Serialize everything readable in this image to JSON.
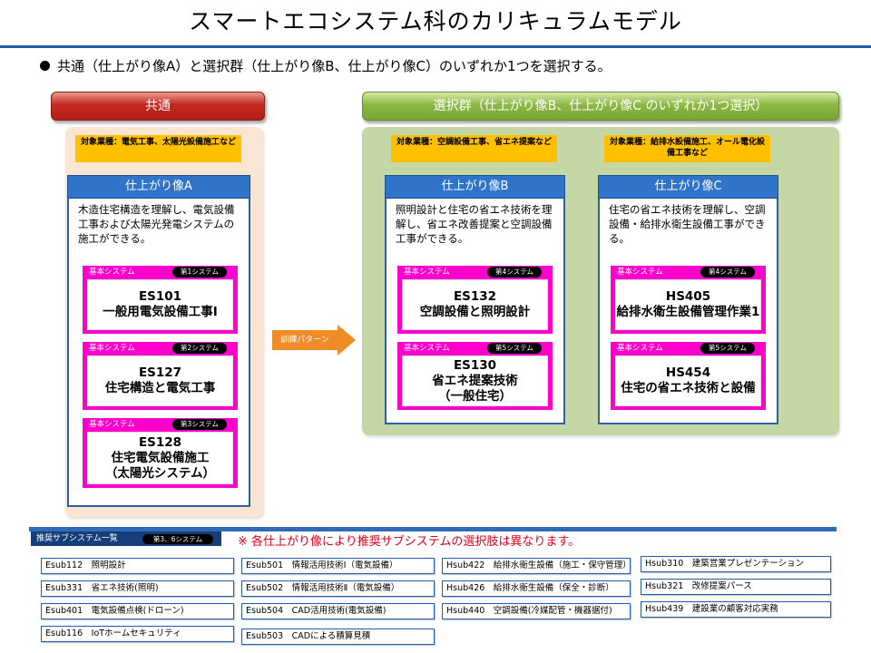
{
  "title": "スマートエコシステム科のカリキュラムモデル",
  "intro": "共通（仕上がり像A）と選択群（仕上がり像B、仕上がり像C）のいずれか1つを選択する。",
  "common": {
    "header": "共通",
    "target": "対象業種：電気工事、太陽光設備施工など",
    "image": {
      "label": "仕上がり像A",
      "desc": "木造住宅構造を理解し、電気設備工事および太陽光発電システムの施工ができる。",
      "systems": [
        {
          "cat": "基本システム",
          "num": "第1システム",
          "code": "ES101",
          "name": "一般用電気設備工事Ⅰ"
        },
        {
          "cat": "基本システム",
          "num": "第2システム",
          "code": "ES127",
          "name": "住宅構造と電気工事"
        },
        {
          "cat": "基本システム",
          "num": "第3システム",
          "code": "ES128",
          "name": "住宅電気設備施工",
          "name2": "（太陽光システム）"
        }
      ]
    }
  },
  "arrow_label": "訓練パターン",
  "select": {
    "header": "選択群（仕上がり像B、仕上がり像C のいずれか1つ選択）",
    "images": [
      {
        "target": "対象業種：空調設備工事、省エネ提案など",
        "label": "仕上がり像B",
        "desc": "照明設計と住宅の省エネ技術を理解し、省エネ改善提案と空調設備工事ができる。",
        "systems": [
          {
            "cat": "基本システム",
            "num": "第4システム",
            "code": "ES132",
            "name": "空調設備と照明設計"
          },
          {
            "cat": "基本システム",
            "num": "第5システム",
            "code": "ES130",
            "name": "省エネ提案技術",
            "name2": "（一般住宅）"
          }
        ]
      },
      {
        "target": "対象業種：給排水設備施工、オール電化設備工事など",
        "label": "仕上がり像C",
        "desc": "住宅の省エネ技術を理解し、空調設備・給排水衛生設備工事ができる。",
        "systems": [
          {
            "cat": "基本システム",
            "num": "第4システム",
            "code": "HS405",
            "name": "給排水衛生設備管理作業1"
          },
          {
            "cat": "基本システム",
            "num": "第5システム",
            "code": "HS454",
            "name": "住宅の省エネ技術と設備"
          }
        ]
      }
    ]
  },
  "recommended": {
    "label": "推奨サブシステム一覧",
    "pill": "第3、6システム",
    "note": "※ 各仕上がり像により推奨サブシステムの選択肢は異なります。",
    "columns": [
      [
        "Esub112　照明設計",
        "Esub331　省エネ技術(照明)",
        "Esub401　電気設備点検(ドローン)",
        "Esub116　IoTホームセキュリティ"
      ],
      [
        "Esub501　情報活用技術Ⅰ（電気設備）",
        "Esub502　情報活用技術Ⅱ（電気設備）",
        "Esub504　CAD活用技術(電気設備)",
        "Esub503　CADによる積算見積"
      ],
      [
        "Hsub422　給排水衛生設備（施工・保守管理）",
        "Hsub426　給排水衛生設備（保全・診断）",
        "Hsub440　空調設備(冷媒配管・機器据付)"
      ],
      [
        "Hsub310　建築営業プレゼンテーション",
        "Hsub321　改修提案パース",
        "Hsub439　建設業の顧客対応実務"
      ]
    ]
  }
}
